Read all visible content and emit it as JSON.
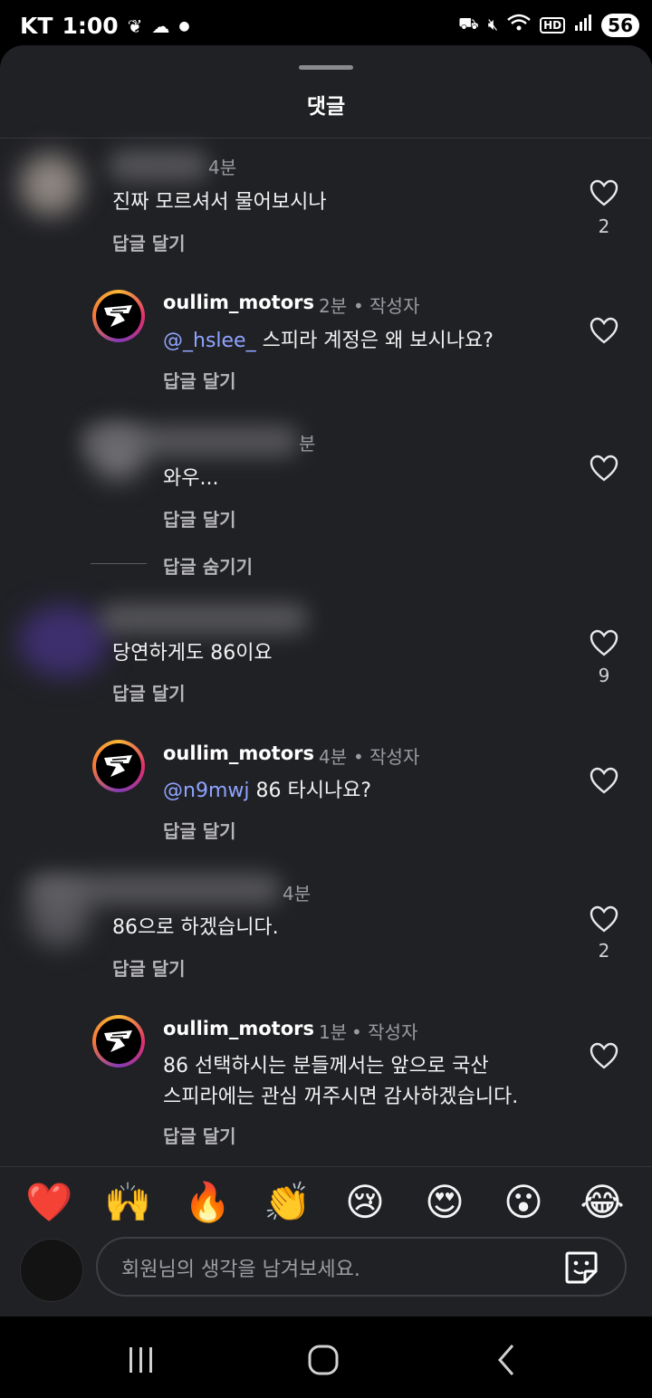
{
  "status": {
    "carrier": "KT",
    "time": "1:00",
    "battery": "56",
    "hd": "HD"
  },
  "sheet": {
    "title": "댓글"
  },
  "comments": [
    {
      "time": "4분",
      "text": "진짜 모르셔서 물어보시나",
      "reply": "답글 달기",
      "likes": "2"
    },
    {
      "user": "oullim_motors",
      "time": "2분",
      "author_tag": "• 작성자",
      "mention": "@_hslee_",
      "text": " 스피라 계정은 왜 보시나요?",
      "reply": "답글 달기"
    },
    {
      "time": "분",
      "text": "와우...",
      "reply": "답글 달기",
      "hide": "답글 숨기기"
    },
    {
      "text": "당연하게도 86이요",
      "reply": "답글 달기",
      "likes": "9"
    },
    {
      "user": "oullim_motors",
      "time": "4분",
      "author_tag": "• 작성자",
      "mention": "@n9mwj",
      "text": " 86 타시나요?",
      "reply": "답글 달기"
    },
    {
      "time": "4분",
      "text": "86으로 하겠습니다.",
      "reply": "답글 달기",
      "likes": "2"
    },
    {
      "user": "oullim_motors",
      "time": "1분",
      "author_tag": "• 작성자",
      "text_line1": "86 선택하시는 분들께서는 앞으로 국산",
      "text_line2": "스피라에는 관심 꺼주시면 감사하겠습니다.",
      "reply": "답글 달기"
    }
  ],
  "emojis": [
    "❤️",
    "🙌",
    "🔥",
    "👏",
    "😢",
    "😍",
    "😮",
    "😂"
  ],
  "input": {
    "placeholder": "회원님의 생각을 남겨보세요."
  },
  "icons": [
    "leaf-icon",
    "weather-icon",
    "dnd-icon",
    "mute-icon",
    "wifi-icon",
    "signal-icon",
    "heart-icon",
    "sticker-icon",
    "recents-icon",
    "home-icon",
    "back-icon"
  ]
}
